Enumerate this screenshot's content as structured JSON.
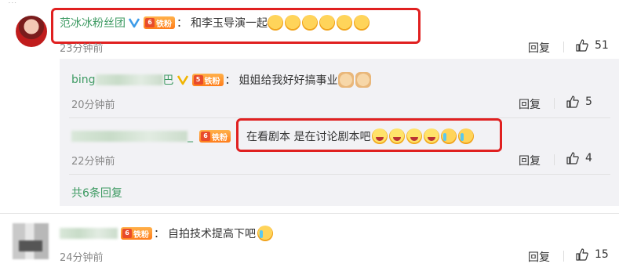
{
  "comments": [
    {
      "user": "范冰冰粉丝团",
      "badge": "铁粉",
      "badge_level": "6",
      "text": "和李玉导演一起",
      "time": "23分钟前",
      "reply_label": "回复",
      "likes": "51"
    },
    {
      "user": "自拍技术提高下吧",
      "badge": "铁粉",
      "text": "自拍技术提高下吧",
      "time": "24分钟前",
      "reply_label": "回复",
      "likes": "15"
    }
  ],
  "replies": [
    {
      "user_prefix": "bing",
      "user_suffix": "巴",
      "badge": "铁粉",
      "badge_level": "5",
      "text": "姐姐给我好好搞事业",
      "time": "20分钟前",
      "reply_label": "回复",
      "likes": "5"
    },
    {
      "user_suffix": "_",
      "badge": "铁粉",
      "badge_level": "6",
      "text": "在看剧本 是在讨论剧本吧",
      "time": "22分钟前",
      "reply_label": "回复",
      "likes": "4"
    }
  ],
  "more_replies": "共6条回复",
  "colors": {
    "username": "#3d9a62",
    "highlight": "#e02020",
    "panel": "#f2f2f5"
  },
  "icons": [
    "verified-v-icon",
    "fan-badge-icon",
    "like-thumb-icon",
    "smirk-emoji-icon",
    "doge-emoji-icon",
    "ok-hand-emoji-icon",
    "laugh-emoji-icon",
    "cry-laugh-emoji-icon"
  ]
}
